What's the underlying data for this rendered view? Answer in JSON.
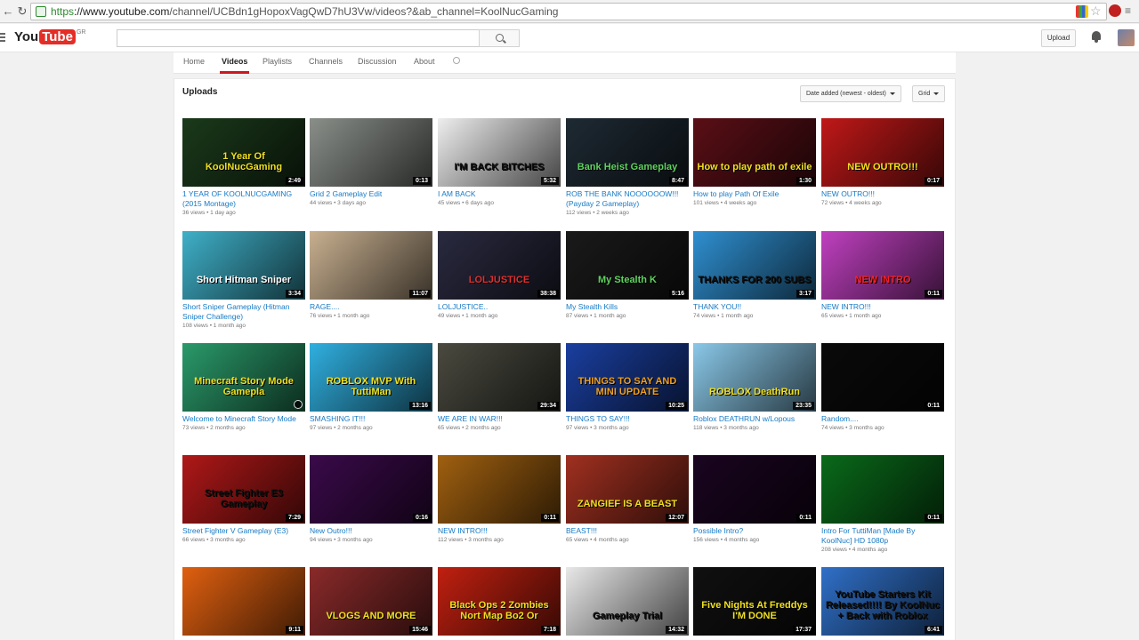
{
  "browser": {
    "url_proto": "https",
    "url_host": "://www.youtube.com",
    "url_path": "/channel/UCBdn1gHopoxVagQwD7hU3Vw/videos?&ab_channel=KoolNucGaming"
  },
  "masthead": {
    "logo_you": "You",
    "logo_tube": "Tube",
    "region": "GR",
    "upload_label": "Upload"
  },
  "tabs": [
    "Home",
    "Videos",
    "Playlists",
    "Channels",
    "Discussion",
    "About"
  ],
  "section": {
    "title": "Uploads",
    "sort_label": "Date added (newest - oldest)",
    "view_label": "Grid"
  },
  "videos": [
    {
      "title": "1 YEAR OF KOOLNUCGAMING (2015 Montage)",
      "meta": "36 views • 1 day ago",
      "duration": "2:49",
      "thumb_text": "1 Year Of KoolNucGaming",
      "bg": "#1b3a1b",
      "fg": "#f0e020"
    },
    {
      "title": "Grid 2 Gameplay Edit",
      "meta": "44 views • 3 days ago",
      "duration": "0:13",
      "thumb_text": "",
      "bg": "#8a8f8a",
      "fg": "#ffffff"
    },
    {
      "title": "I AM BACK",
      "meta": "45 views • 6 days ago",
      "duration": "5:32",
      "thumb_text": "I'M BACK BITCHES",
      "bg": "#eeeeee",
      "fg": "#111111"
    },
    {
      "title": "ROB THE BANK NOOOOOOW!!! (Payday 2 Gameplay)",
      "meta": "112 views • 2 weeks ago",
      "duration": "8:47",
      "thumb_text": "Bank Heist Gameplay",
      "bg": "#1e2a33",
      "fg": "#5fd35f"
    },
    {
      "title": "How to play Path Of Exile",
      "meta": "101 views • 4 weeks ago",
      "duration": "1:30",
      "thumb_text": "How to play path of exile",
      "bg": "#5a0f16",
      "fg": "#f0e020"
    },
    {
      "title": "NEW OUTRO!!!",
      "meta": "72 views • 4 weeks ago",
      "duration": "0:17",
      "thumb_text": "NEW OUTRO!!!",
      "bg": "#c01818",
      "fg": "#f0e020"
    },
    {
      "title": "Short Sniper Gameplay (Hitman Sniper Challenge)",
      "meta": "108 views • 1 month ago",
      "duration": "3:34",
      "thumb_text": "Short Hitman Sniper",
      "bg": "#3fb0c8",
      "fg": "#ffffff"
    },
    {
      "title": "RAGE....",
      "meta": "76 views • 1 month ago",
      "duration": "11:07",
      "thumb_text": "",
      "bg": "#c8b090",
      "fg": "#ffffff"
    },
    {
      "title": "LOLJUSTICE..",
      "meta": "49 views • 1 month ago",
      "duration": "38:38",
      "thumb_text": "LOLJUSTICE",
      "bg": "#2a2a40",
      "fg": "#e03030"
    },
    {
      "title": "My Stealth Kills",
      "meta": "87 views • 1 month ago",
      "duration": "5:16",
      "thumb_text": "My Stealth K",
      "bg": "#1a1a1a",
      "fg": "#5fd35f"
    },
    {
      "title": "THANK YOU!!",
      "meta": "74 views • 1 month ago",
      "duration": "3:17",
      "thumb_text": "THANKS FOR 200 SUBS",
      "bg": "#2f8fd0",
      "fg": "#111111"
    },
    {
      "title": "NEW INTRO!!!",
      "meta": "65 views • 1 month ago",
      "duration": "0:11",
      "thumb_text": "NEW INTRO",
      "bg": "#c040c0",
      "fg": "#ff2020"
    },
    {
      "title": "Welcome to Minecraft Story Mode",
      "meta": "73 views • 2 months ago",
      "duration": "",
      "thumb_text": "Minecraft Story Mode Gamepla",
      "bg": "#2a9a6a",
      "fg": "#f0e020"
    },
    {
      "title": "SMASHING IT!!!",
      "meta": "97 views • 2 months ago",
      "duration": "13:16",
      "thumb_text": "ROBLOX MVP With TuttiMan",
      "bg": "#30b0e0",
      "fg": "#f0e020"
    },
    {
      "title": "WE ARE IN WAR!!!",
      "meta": "65 views • 2 months ago",
      "duration": "29:34",
      "thumb_text": "",
      "bg": "#4a4a40",
      "fg": "#ffffff"
    },
    {
      "title": "THINGS TO SAY!!!",
      "meta": "97 views • 3 months ago",
      "duration": "10:25",
      "thumb_text": "THINGS TO SAY AND MINI UPDATE",
      "bg": "#1a3fa0",
      "fg": "#f0a020"
    },
    {
      "title": "Roblox DEATHRUN w/Lopous",
      "meta": "118 views • 3 months ago",
      "duration": "23:35",
      "thumb_text": "ROBLOX DeathRun",
      "bg": "#8ac8e8",
      "fg": "#f0e020"
    },
    {
      "title": "Random....",
      "meta": "74 views • 3 months ago",
      "duration": "0:11",
      "thumb_text": "",
      "bg": "#0a0a0a",
      "fg": "#ffffff"
    },
    {
      "title": "Street Fighter V Gameplay (E3)",
      "meta": "66 views • 3 months ago",
      "duration": "7:29",
      "thumb_text": "Street Fighter E3 Gameplay",
      "bg": "#b01818",
      "fg": "#111111"
    },
    {
      "title": "New Outro!!!",
      "meta": "94 views • 3 months ago",
      "duration": "0:16",
      "thumb_text": "",
      "bg": "#3a0a4a",
      "fg": "#ffffff"
    },
    {
      "title": "NEW INTRO!!!",
      "meta": "112 views • 3 months ago",
      "duration": "0:11",
      "thumb_text": "",
      "bg": "#a06010",
      "fg": "#ffffff"
    },
    {
      "title": "BEAST!!!",
      "meta": "65 views • 4 months ago",
      "duration": "12:07",
      "thumb_text": "ZANGIEF IS A BEAST",
      "bg": "#a03020",
      "fg": "#f0e020"
    },
    {
      "title": "Possible Intro?",
      "meta": "156 views • 4 months ago",
      "duration": "0:11",
      "thumb_text": "",
      "bg": "#1a0520",
      "fg": "#ffffff"
    },
    {
      "title": "Intro For TuttiMan [Made By KoolNuc] HD 1080p",
      "meta": "208 views • 4 months ago",
      "duration": "0:11",
      "thumb_text": "",
      "bg": "#0a6a1a",
      "fg": "#ffffff"
    },
    {
      "title": "",
      "meta": "",
      "duration": "9:11",
      "thumb_text": "",
      "bg": "#e06010",
      "fg": "#f0e020"
    },
    {
      "title": "",
      "meta": "",
      "duration": "15:46",
      "thumb_text": "VLOGS AND MORE",
      "bg": "#8a2a2a",
      "fg": "#f0e020"
    },
    {
      "title": "",
      "meta": "",
      "duration": "7:18",
      "thumb_text": "Black Ops 2 Zombies Nort Map Bo2 Or",
      "bg": "#c02010",
      "fg": "#f0e020"
    },
    {
      "title": "",
      "meta": "",
      "duration": "14:32",
      "thumb_text": "Gameplay Trial",
      "bg": "#e8e8e8",
      "fg": "#111111"
    },
    {
      "title": "",
      "meta": "",
      "duration": "17:37",
      "thumb_text": "Five Nights At Freddys I'M DONE",
      "bg": "#101010",
      "fg": "#f0e020"
    },
    {
      "title": "",
      "meta": "",
      "duration": "6:41",
      "thumb_text": "YouTube Starters Kit Released!!!! By KoolNuc + Back with Roblox",
      "bg": "#3070c8",
      "fg": "#111111"
    }
  ]
}
